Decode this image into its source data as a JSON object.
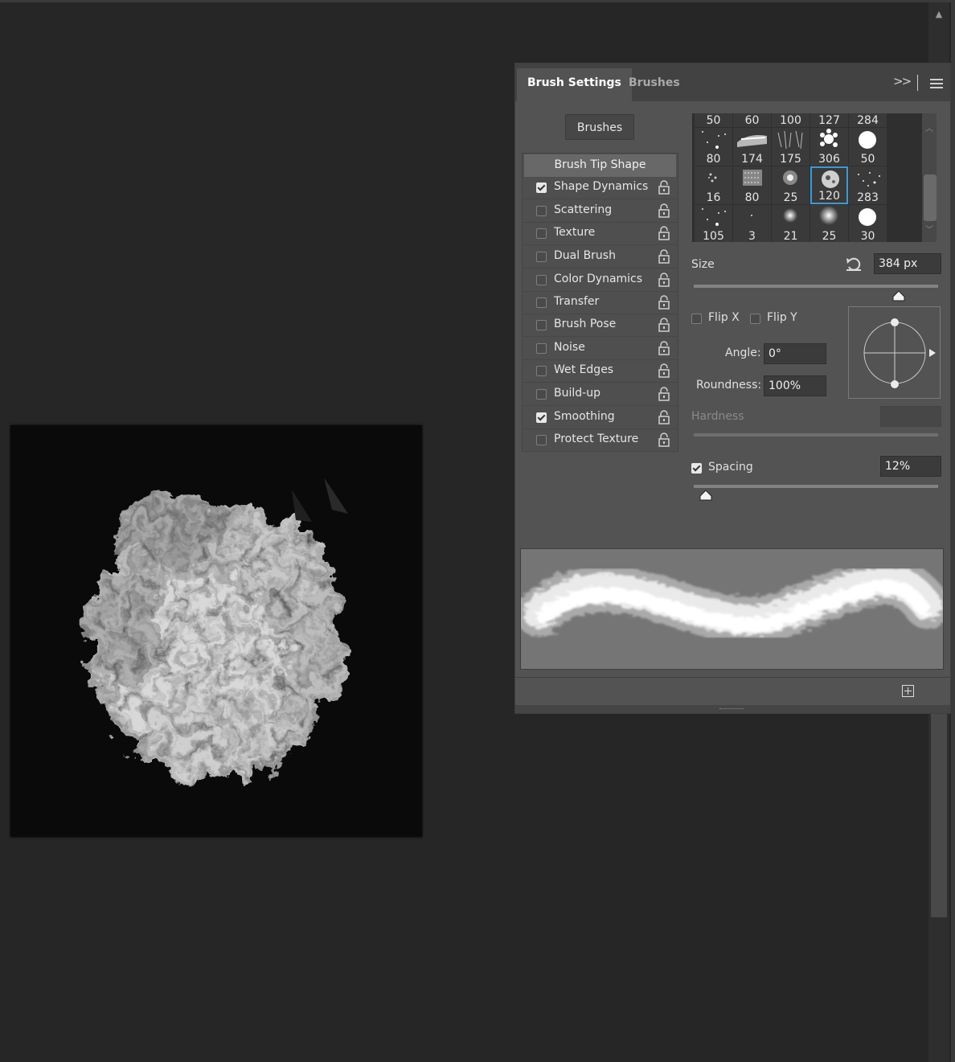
{
  "panel": {
    "tabs": [
      {
        "label": "Brush Settings",
        "active": true
      },
      {
        "label": "Brushes",
        "active": false
      }
    ],
    "collapse_label": ">>",
    "brushes_button": "Brushes"
  },
  "options": {
    "header": "Brush Tip Shape",
    "items": [
      {
        "label": "Shape Dynamics",
        "checked": true
      },
      {
        "label": "Scattering",
        "checked": false
      },
      {
        "label": "Texture",
        "checked": false
      },
      {
        "label": "Dual Brush",
        "checked": false
      },
      {
        "label": "Color Dynamics",
        "checked": false
      },
      {
        "label": "Transfer",
        "checked": false
      },
      {
        "label": "Brush Pose",
        "checked": false
      },
      {
        "label": "Noise",
        "checked": false
      },
      {
        "label": "Wet Edges",
        "checked": false
      },
      {
        "label": "Build-up",
        "checked": false
      },
      {
        "label": "Smoothing",
        "checked": true
      },
      {
        "label": "Protect Texture",
        "checked": false
      }
    ]
  },
  "brush_grid": {
    "top_row_partial": [
      "50",
      "60",
      "100",
      "127",
      "284"
    ],
    "rows": [
      [
        "80",
        "174",
        "175",
        "306",
        "50"
      ],
      [
        "16",
        "80",
        "25",
        "120",
        "283"
      ],
      [
        "105",
        "3",
        "21",
        "25",
        "30"
      ]
    ],
    "selected": "120"
  },
  "tip": {
    "size_label": "Size",
    "size_value": "384 px",
    "size_fraction": 0.84,
    "flip_x_label": "Flip X",
    "flip_y_label": "Flip Y",
    "flip_x": false,
    "flip_y": false,
    "angle_label": "Angle:",
    "angle_value": "0°",
    "roundness_label": "Roundness:",
    "roundness_value": "100%",
    "hardness_label": "Hardness",
    "spacing_label": "Spacing",
    "spacing_checked": true,
    "spacing_value": "12%",
    "spacing_fraction": 0.05
  },
  "colors": {
    "selection_accent": "#2aa0e8"
  }
}
